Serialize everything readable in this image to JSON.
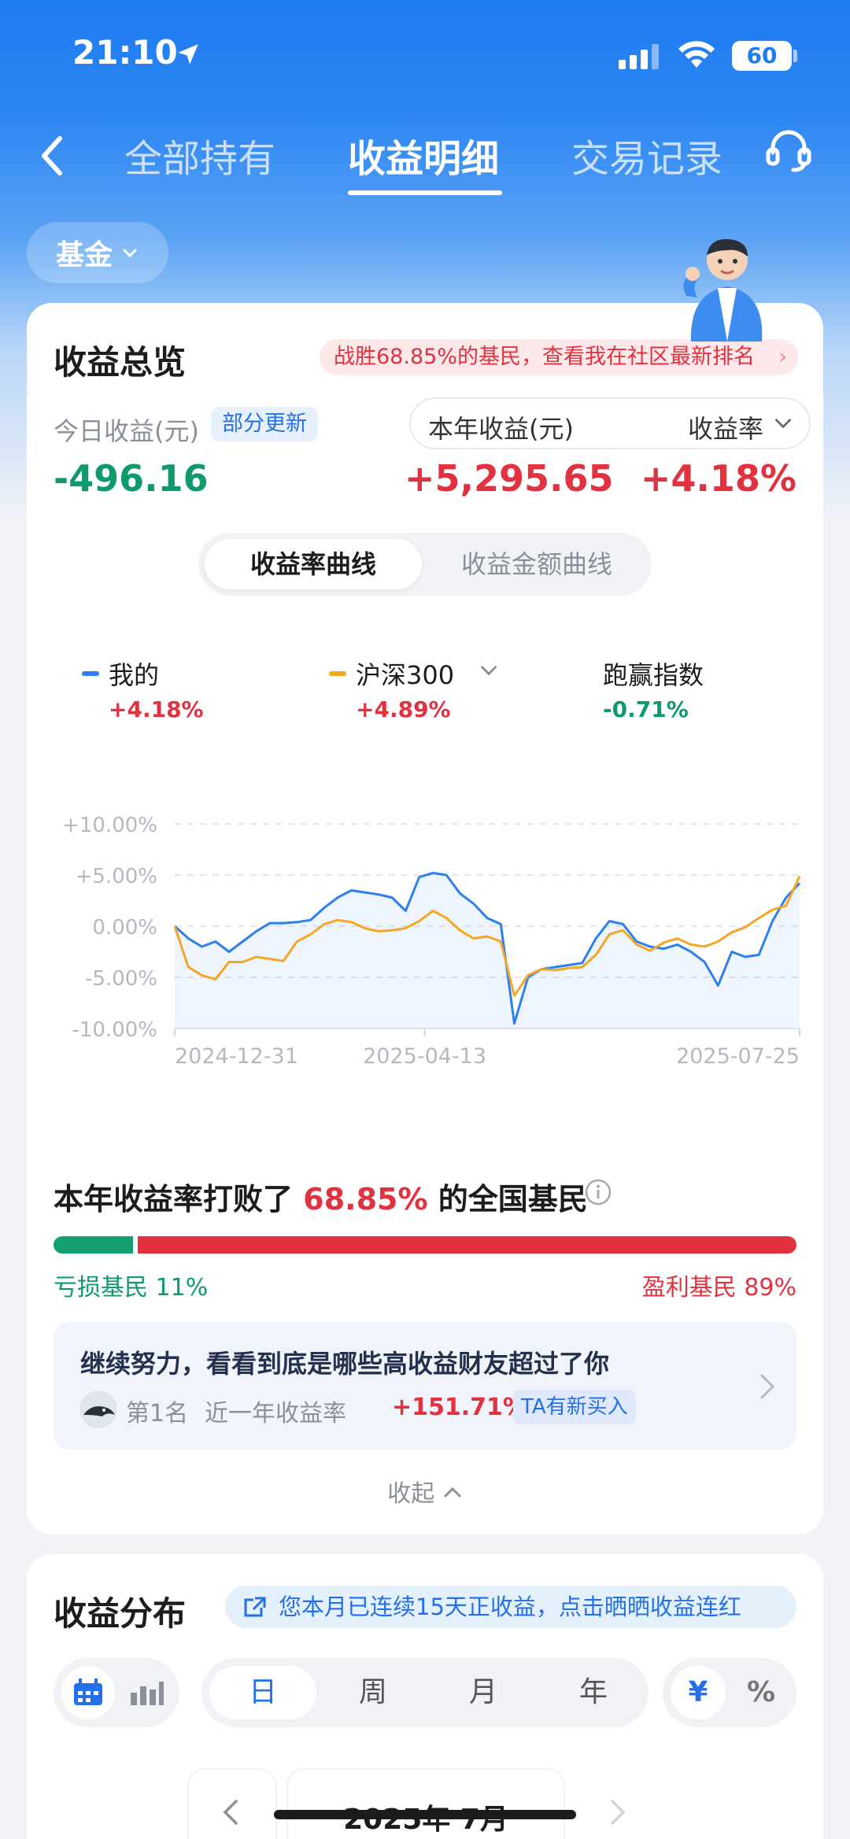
{
  "status": {
    "time": "21:10",
    "battery": "60"
  },
  "nav": {
    "tabs": [
      {
        "label": "全部持有"
      },
      {
        "label": "收益明细"
      },
      {
        "label": "交易记录"
      }
    ]
  },
  "filter": {
    "label": "基金"
  },
  "overview": {
    "title": "收益总览",
    "rank_banner": "战胜68.85%的基民，查看我在社区最新排名",
    "today_label": "今日收益(元)",
    "update_badge": "部分更新",
    "today_value": "-496.16",
    "year_label": "本年收益(元)",
    "rate_label": "收益率",
    "year_value": "+5,295.65",
    "rate_value": "+4.18%",
    "curve_tabs": [
      "收益率曲线",
      "收益金额曲线"
    ]
  },
  "legend": {
    "mine": {
      "name": "我的",
      "value": "+4.18%"
    },
    "index": {
      "name": "沪深300",
      "value": "+4.89%"
    },
    "beat": {
      "name": "跑赢指数",
      "value": "-0.71%"
    }
  },
  "colors": {
    "mine": "#2c7ff0",
    "index": "#f5a623",
    "red": "#e2323f",
    "green": "#0e9b69"
  },
  "chart_data": {
    "type": "line",
    "ytick_labels": [
      "+10.00%",
      "+5.00%",
      "0.00%",
      "-5.00%",
      "-10.00%"
    ],
    "ylim": [
      -10,
      10
    ],
    "xtick_labels": [
      "2024-12-31",
      "2025-04-13",
      "2025-07-25"
    ],
    "series": [
      {
        "name": "我的",
        "color": "#2c7ff0",
        "values": [
          0,
          -1.2,
          -2,
          -1.5,
          -2.5,
          -1.5,
          -0.5,
          0.3,
          0.3,
          0.4,
          0.6,
          1.8,
          2.8,
          3.5,
          3.3,
          3.1,
          2.8,
          1.5,
          4.8,
          5.2,
          5.0,
          3.2,
          2.2,
          0.8,
          0.2,
          -9.5,
          -5.0,
          -4.2,
          -4.0,
          -3.8,
          -3.6,
          -1.2,
          0.5,
          0.2,
          -1.5,
          -2.0,
          -2.2,
          -1.8,
          -2.5,
          -3.5,
          -5.8,
          -2.5,
          -3.0,
          -2.8,
          0.5,
          2.8,
          4.2
        ]
      },
      {
        "name": "沪深300",
        "color": "#f5a623",
        "values": [
          0,
          -4.0,
          -4.8,
          -5.2,
          -3.5,
          -3.5,
          -3.0,
          -3.2,
          -3.4,
          -1.5,
          -0.8,
          0.2,
          0.6,
          0.4,
          -0.2,
          -0.5,
          -0.4,
          -0.2,
          0.5,
          1.5,
          0.8,
          -0.4,
          -1.2,
          -1.0,
          -1.5,
          -6.8,
          -4.8,
          -4.2,
          -4.3,
          -4.1,
          -4.0,
          -2.8,
          -0.8,
          -0.4,
          -1.8,
          -2.4,
          -1.6,
          -1.2,
          -1.8,
          -2.0,
          -1.5,
          -0.6,
          -0.1,
          0.8,
          1.6,
          2.0,
          4.89
        ]
      }
    ]
  },
  "beat": {
    "prefix": "本年收益率打败了",
    "pct": "68.85%",
    "suffix": "的全国基民",
    "loss_pct": 11,
    "profit_pct": 89,
    "loss_label": "亏损基民 11%",
    "profit_label": "盈利基民 89%"
  },
  "promo": {
    "title": "继续努力，看看到底是哪些高收益财友超过了你",
    "rank": "第1名",
    "near_label": "近一年收益率",
    "near_value": "+151.71%",
    "badge": "TA有新买入"
  },
  "collapse_label": "收起",
  "distribution": {
    "title": "收益分布",
    "streak": "您本月已连续15天正收益，点击晒晒收益连红",
    "periods": [
      "日",
      "周",
      "月",
      "年"
    ],
    "units": [
      "¥",
      "%"
    ],
    "month": "2025年 7月"
  }
}
